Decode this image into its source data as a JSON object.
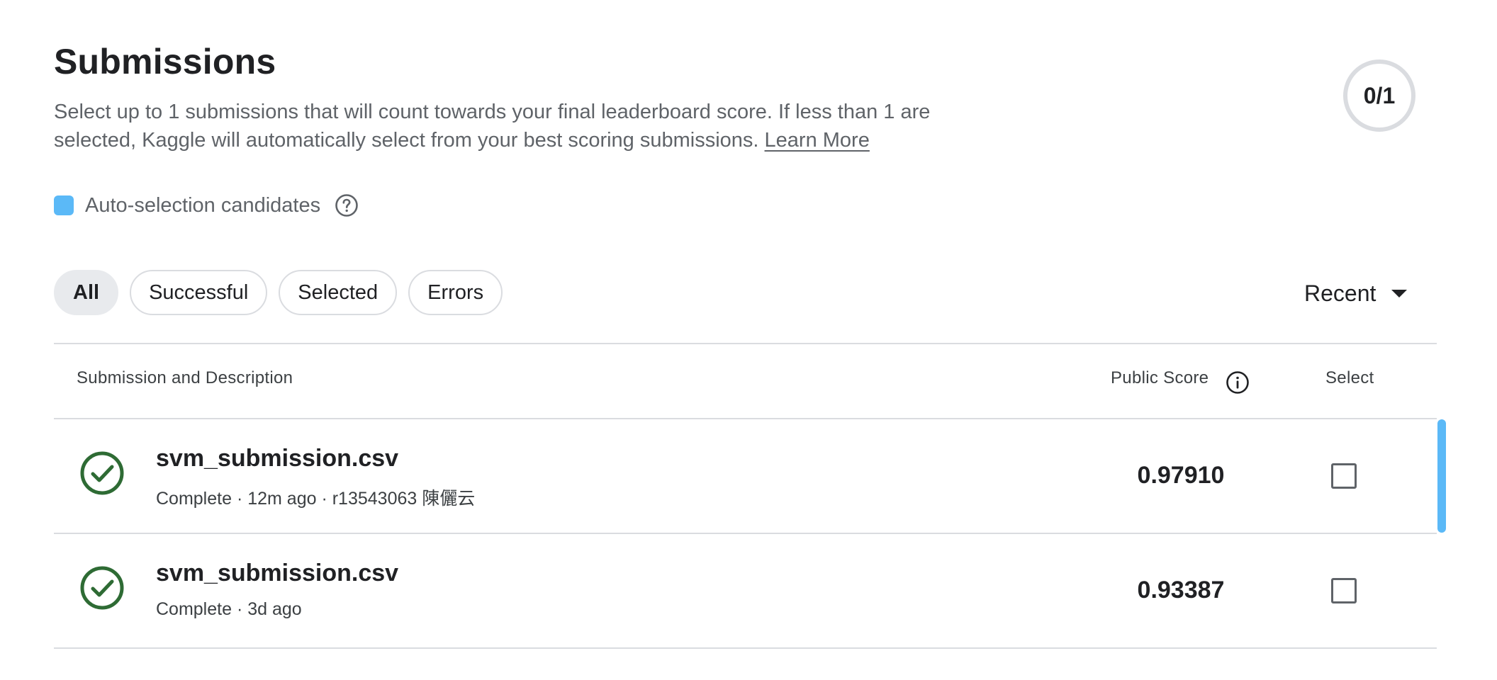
{
  "header": {
    "title": "Submissions",
    "description": "Select up to 1 submissions that will count towards your final leaderboard score. If less than 1 are selected, Kaggle will automatically select from your best scoring submissions.",
    "learn_more": "Learn More",
    "counter": "0/1"
  },
  "legend": {
    "label": "Auto-selection candidates",
    "color": "#5bb9f7",
    "icon": "help-circle-icon"
  },
  "filters": {
    "items": [
      {
        "label": "All",
        "active": true
      },
      {
        "label": "Successful",
        "active": false
      },
      {
        "label": "Selected",
        "active": false
      },
      {
        "label": "Errors",
        "active": false
      }
    ]
  },
  "sort": {
    "label": "Recent",
    "icon": "caret-down-icon"
  },
  "table": {
    "columns": {
      "submission": "Submission and Description",
      "score": "Public Score",
      "select": "Select"
    },
    "rows": [
      {
        "name": "svm_submission.csv",
        "meta": "Complete · 12m ago · r13543063 陳儷云",
        "score": "0.97910",
        "status_icon": "check-circle-icon",
        "auto_selection_candidate": true,
        "selected": false
      },
      {
        "name": "svm_submission.csv",
        "meta": "Complete · 3d ago",
        "score": "0.93387",
        "status_icon": "check-circle-icon",
        "auto_selection_candidate": false,
        "selected": false
      }
    ]
  },
  "colors": {
    "success": "#2e6b34",
    "accent": "#5bb9f7"
  }
}
